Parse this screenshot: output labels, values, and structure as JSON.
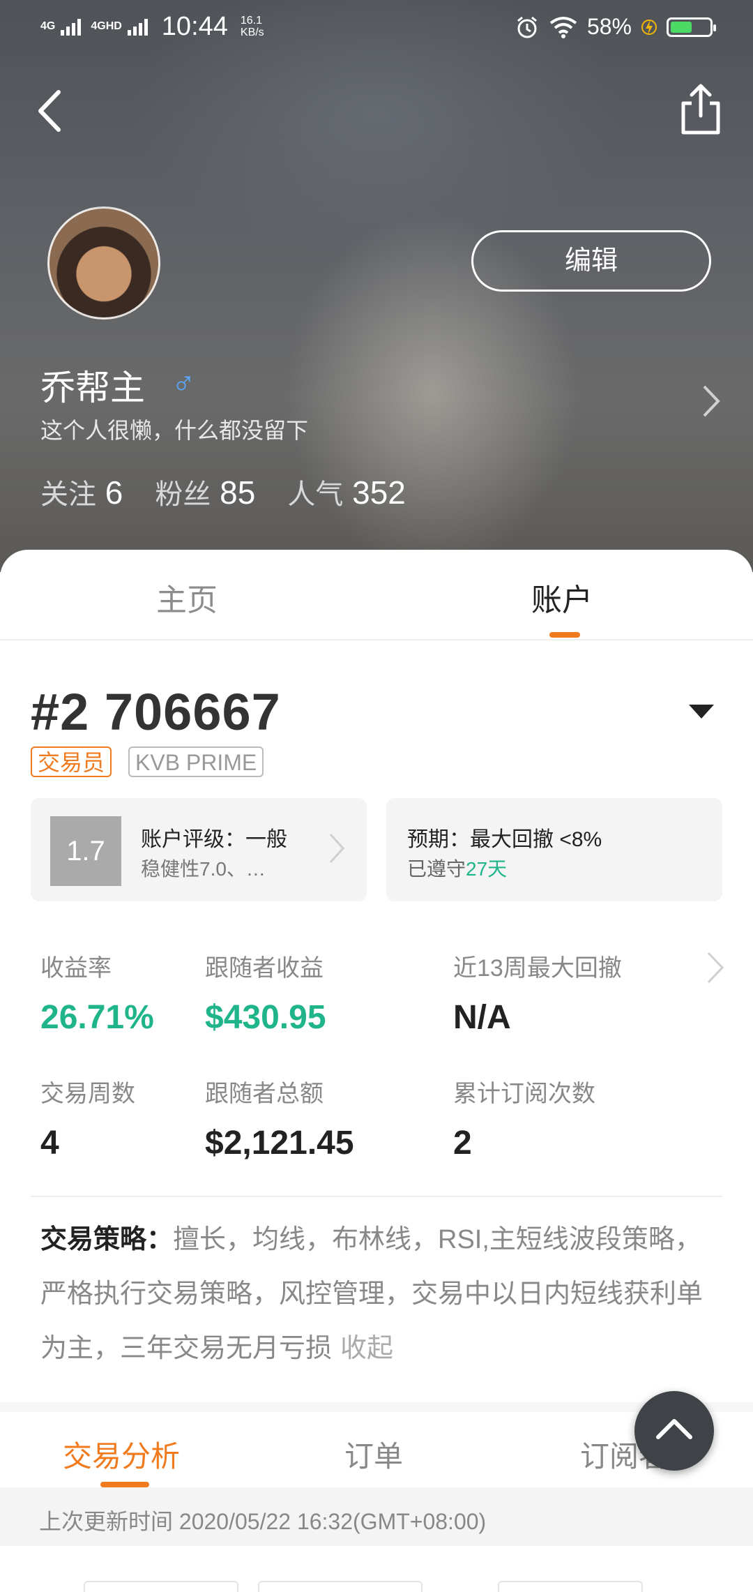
{
  "status_bar": {
    "signal_1": "4G",
    "signal_2": "4GHD",
    "time": "10:44",
    "speed_value": "16.1",
    "speed_unit": "KB/s",
    "battery": "58%",
    "icons": [
      "alarm-icon",
      "wifi-icon",
      "charging-icon",
      "battery-icon"
    ]
  },
  "header": {
    "back_icon": "chevron-left-icon",
    "share_icon": "share-icon",
    "edit_label": "编辑",
    "user_name": "乔帮主",
    "gender_symbol": "♂",
    "bio": "这个人很懒，什么都没留下",
    "stats": [
      {
        "label": "关注",
        "value": "6"
      },
      {
        "label": "粉丝",
        "value": "85"
      },
      {
        "label": "人气",
        "value": "352"
      }
    ]
  },
  "tabs": [
    {
      "label": "主页",
      "active": false
    },
    {
      "label": "账户",
      "active": true
    }
  ],
  "account": {
    "number": "#2 706667",
    "badge_role": "交易员",
    "badge_tier": "KVB PRIME",
    "rating_score": "1.7",
    "rating_title": "账户评级：一般",
    "rating_sub": "稳健性7.0、…",
    "expect_title": "预期：最大回撤 <8%",
    "expect_sub_prefix": "已遵守",
    "expect_sub_days": "27天"
  },
  "metrics": [
    {
      "label": "收益率",
      "value": "26.71%",
      "highlight": true
    },
    {
      "label": "跟随者收益",
      "value": "$430.95",
      "highlight": true
    },
    {
      "label": "近13周最大回撤",
      "value": "N/A",
      "highlight": false
    },
    {
      "label": "交易周数",
      "value": "4",
      "highlight": false
    },
    {
      "label": "跟随者总额",
      "value": "$2,121.45",
      "highlight": false
    },
    {
      "label": "累计订阅次数",
      "value": "2",
      "highlight": false
    }
  ],
  "strategy": {
    "label": "交易策略：",
    "text": "擅长，均线，布林线，RSI,主短线波段策略，严格执行交易策略，风控管理，交易中以日内短线获利单为主，三年交易无月亏损",
    "collapse": "收起"
  },
  "sub_tabs": [
    {
      "label": "交易分析",
      "active": true
    },
    {
      "label": "订单",
      "active": false
    },
    {
      "label": "订阅者",
      "active": false
    }
  ],
  "update": {
    "text": "上次更新时间 2020/05/22 16:32(GMT+08:00)"
  },
  "fab_icon": "chevron-up-icon",
  "colors": {
    "accent_orange": "#f07a1e",
    "positive_green": "#1fb489",
    "gender_blue": "#5aa8ff"
  }
}
